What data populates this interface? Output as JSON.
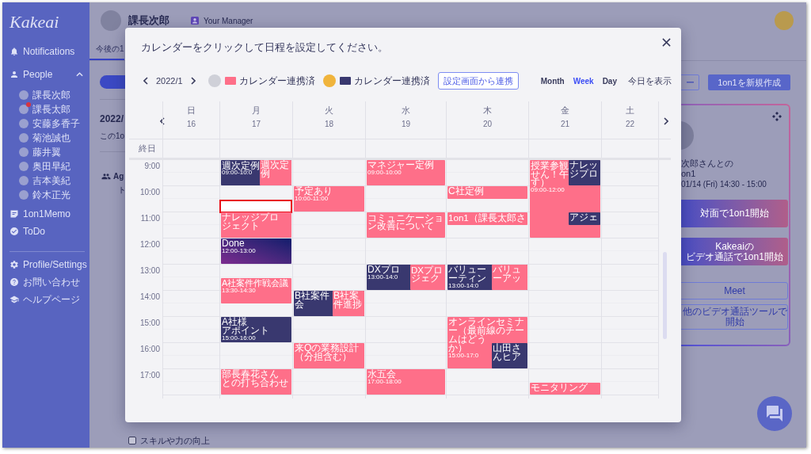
{
  "sidebar": {
    "logo": "Kakeai",
    "nav": [
      {
        "kind": "notifications",
        "label": "Notifications"
      },
      {
        "kind": "people",
        "label": "People",
        "expanded": true,
        "children": [
          {
            "name": "課長次郎",
            "notified": false
          },
          {
            "name": "課長太郎",
            "notified": true
          },
          {
            "name": "安藤多香子",
            "notified": false
          },
          {
            "name": "菊池誠也",
            "notified": false
          },
          {
            "name": "藤井翼",
            "notified": false
          },
          {
            "name": "奥田早紀",
            "notified": false
          },
          {
            "name": "吉本美紀",
            "notified": false
          },
          {
            "name": "鈴木正光",
            "notified": false
          }
        ]
      },
      {
        "kind": "memo",
        "label": "1on1Memo"
      },
      {
        "kind": "todo",
        "label": "ToDo"
      }
    ],
    "footer_nav": [
      {
        "kind": "settings",
        "label": "Profile/Settings"
      },
      {
        "kind": "contact",
        "label": "お問い合わせ"
      },
      {
        "kind": "help",
        "label": "ヘルプページ"
      }
    ]
  },
  "header": {
    "user_name": "課長次郎",
    "role": "Your Manager"
  },
  "tabs": [
    {
      "label": "今後の1",
      "selected": true
    }
  ],
  "summary": {
    "heading": "2022/",
    "description": "この1o",
    "agenda_title": "Ag",
    "agenda_text": "ト",
    "checklist": [
      {
        "label": "スキルや力の向上",
        "checked": false
      }
    ]
  },
  "actions": {
    "secondary_button": "ー",
    "create_button": "1on1を新規作成"
  },
  "next_meeting": {
    "title": "次郎さんとの",
    "subtitle": "on1",
    "datetime": "01/14 (Fri) 14:30 - 15:00",
    "buttons": [
      {
        "kind": "gradient",
        "label_lines": [
          "対面で1on1開始"
        ]
      },
      {
        "kind": "gradient",
        "label_lines": [
          "Kakeaiの",
          "ビデオ通話で1on1開始"
        ]
      },
      {
        "kind": "outline",
        "label_lines": [
          "Meet"
        ]
      },
      {
        "kind": "outline",
        "label_lines": [
          "他のビデオ通話ツールで開始"
        ]
      }
    ]
  },
  "modal": {
    "instruction": "カレンダーをクリックして日程を設定してください。",
    "period": "2022/1",
    "calendars": [
      {
        "color": "#fe6f89",
        "label": "カレンダー連携済"
      },
      {
        "color": "#39386f",
        "label": "カレンダー連携済"
      }
    ],
    "connect_button": "設定画面から連携",
    "views": [
      {
        "label": "Month",
        "selected": false
      },
      {
        "label": "Week",
        "selected": true
      },
      {
        "label": "Day",
        "selected": false
      }
    ],
    "today_button": "今日を表示",
    "all_day_label": "終日",
    "hours": [
      "9:00",
      "10:00",
      "11:00",
      "12:00",
      "13:00",
      "14:00",
      "15:00",
      "16:00",
      "17:00"
    ],
    "days": [
      {
        "weekday": "日",
        "date": "16",
        "slot_selected": false
      },
      {
        "weekday": "月",
        "date": "17",
        "slot_selected": true,
        "events": [
          {
            "kind": "event",
            "color": "#39386f",
            "title_lines": [
              "週次定例"
            ],
            "time": "09:00-10:0"
          },
          {
            "kind": "event",
            "color": "#fe6f89",
            "title_lines": [
              "週次定",
              "例"
            ]
          },
          {
            "kind": "event",
            "color": "#fe6f89",
            "title_lines": [
              "ナレッジプロ",
              "ジェクト"
            ]
          },
          {
            "kind": "done",
            "title_lines": [
              "Done"
            ],
            "time": "12:00-13:00"
          },
          {
            "kind": "event",
            "color": "#fe6f89",
            "title_lines": [
              "A社案件作戦会議"
            ],
            "time": "13:30-14:30"
          },
          {
            "kind": "event",
            "color": "#39386f",
            "title_lines": [
              "A社様",
              "アポイント"
            ],
            "time": "15:00-16:00"
          },
          {
            "kind": "event",
            "color": "#fe6f89",
            "title_lines": [
              "部長春花さん",
              "との打ち合わせ"
            ]
          }
        ]
      },
      {
        "weekday": "火",
        "date": "18",
        "slot_selected": false,
        "events": [
          {
            "kind": "event",
            "color": "#fe6f89",
            "title_lines": [
              "予定あり"
            ],
            "time": "10:00-11:00"
          },
          {
            "kind": "event",
            "color": "#39386f",
            "title_lines": [
              "B社案件",
              "会"
            ]
          },
          {
            "kind": "event",
            "color": "#fe6f89",
            "title_lines": [
              "B社案",
              "件進捗"
            ]
          },
          {
            "kind": "event",
            "color": "#fe6f89",
            "title_lines": [
              "来Qの業務設計",
              "（分担含む）"
            ]
          }
        ]
      },
      {
        "weekday": "水",
        "date": "19",
        "slot_selected": false,
        "events": [
          {
            "kind": "event",
            "color": "#fe6f89",
            "title_lines": [
              "マネジャー定例"
            ],
            "time": "09:00-10:00"
          },
          {
            "kind": "event",
            "color": "#fe6f89",
            "title_lines": [
              "コミュニケーショ",
              "ン改善について"
            ]
          },
          {
            "kind": "event",
            "color": "#39386f",
            "title_lines": [
              "DXプロ"
            ],
            "time": "13:00-14:0"
          },
          {
            "kind": "event",
            "color": "#fe6f89",
            "title_lines": [
              "DXプロ",
              "ジェク"
            ]
          },
          {
            "kind": "event",
            "color": "#fe6f89",
            "title_lines": [
              "水五会"
            ],
            "time": "17:00-18:00"
          }
        ]
      },
      {
        "weekday": "木",
        "date": "20",
        "slot_selected": false,
        "events": [
          {
            "kind": "event",
            "color": "#fe6f89",
            "title_lines": [
              "C社定例"
            ]
          },
          {
            "kind": "event",
            "color": "#fe6f89",
            "title_lines": [
              "1on1（課長太郎さ"
            ]
          },
          {
            "kind": "event",
            "color": "#39386f",
            "title_lines": [
              "バリュー",
              "ーティン"
            ],
            "time": "13:00-14:0"
          },
          {
            "kind": "event",
            "color": "#fe6f89",
            "title_lines": [
              "バリュ",
              "ーアッ"
            ]
          },
          {
            "kind": "event",
            "color": "#fe6f89",
            "title_lines": [
              "オンラインセミナ",
              "ー（最前線のチー",
              "ムはどう",
              "か）"
            ],
            "time": "15:00-17:0"
          },
          {
            "kind": "event",
            "color": "#39386f",
            "title_lines": [
              "山田さ",
              "んヒア"
            ]
          }
        ]
      },
      {
        "weekday": "金",
        "date": "21",
        "slot_selected": false,
        "events": [
          {
            "kind": "event",
            "color": "#fe6f89",
            "title_lines": [
              "授業参観",
              "せん！午",
              "す）"
            ],
            "time": "09:00-12:00"
          },
          {
            "kind": "event",
            "color": "#39386f",
            "title_lines": [
              "ナレッ",
              "ジプロ"
            ]
          },
          {
            "kind": "event",
            "color": "#39386f",
            "title_lines": [
              "アジェ"
            ]
          },
          {
            "kind": "event",
            "color": "#fe6f89",
            "title_lines": [
              "モニタリング"
            ]
          }
        ]
      },
      {
        "weekday": "土",
        "date": "22",
        "slot_selected": false
      }
    ]
  }
}
